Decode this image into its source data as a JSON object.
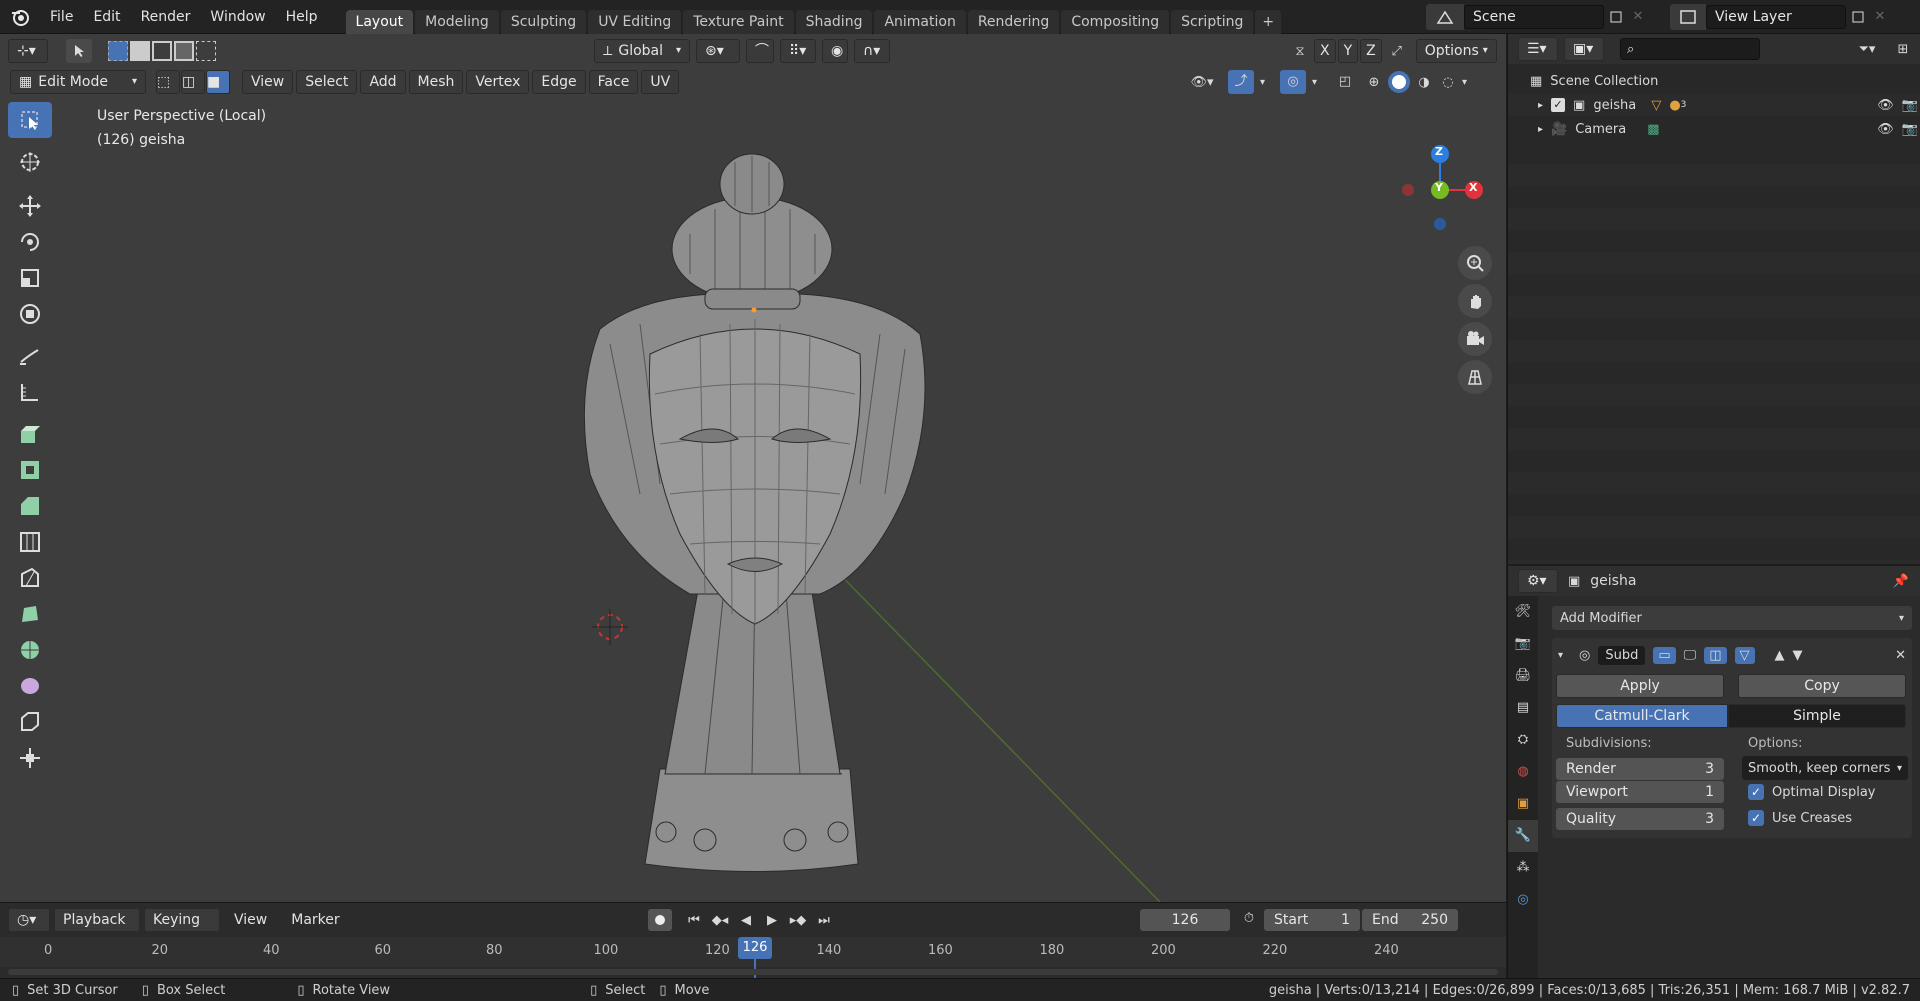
{
  "menu": [
    "File",
    "Edit",
    "Render",
    "Window",
    "Help"
  ],
  "workspaces": [
    "Layout",
    "Modeling",
    "Sculpting",
    "UV Editing",
    "Texture Paint",
    "Shading",
    "Animation",
    "Rendering",
    "Compositing",
    "Scripting"
  ],
  "active_workspace": "Layout",
  "scene_name": "Scene",
  "view_layer": "View Layer",
  "header": {
    "orientation": "Global",
    "axes": [
      "X",
      "Y",
      "Z"
    ],
    "options_label": "Options",
    "mode": "Edit Mode",
    "menus": [
      "View",
      "Select",
      "Add",
      "Mesh",
      "Vertex",
      "Edge",
      "Face",
      "UV"
    ]
  },
  "viewport": {
    "view_name": "User Perspective (Local)",
    "object_info": "(126) geisha",
    "axes": {
      "z": "Z",
      "y": "Y",
      "x": "X"
    }
  },
  "outliner": {
    "root": "Scene Collection",
    "items": [
      {
        "name": "geisha",
        "badge": "3"
      },
      {
        "name": "Camera",
        "badge": ""
      }
    ]
  },
  "properties": {
    "object_name": "geisha",
    "add_modifier": "Add Modifier",
    "modifier_name": "Subd",
    "apply": "Apply",
    "copy": "Copy",
    "algo_a": "Catmull-Clark",
    "algo_b": "Simple",
    "subdivisions_label": "Subdivisions:",
    "options_label": "Options:",
    "render_label": "Render",
    "render_value": "3",
    "viewport_label": "Viewport",
    "viewport_value": "1",
    "quality_label": "Quality",
    "quality_value": "3",
    "uv_smooth": "Smooth, keep corners",
    "optimal_display": "Optimal Display",
    "use_creases": "Use Creases"
  },
  "timeline": {
    "menus": [
      "Playback",
      "Keying",
      "View",
      "Marker"
    ],
    "current_frame": "126",
    "start_label": "Start",
    "start_value": "1",
    "end_label": "End",
    "end_value": "250",
    "ruler": [
      "0",
      "20",
      "40",
      "60",
      "80",
      "100",
      "120",
      "140",
      "160",
      "180",
      "200",
      "220",
      "240"
    ]
  },
  "status": {
    "left": [
      {
        "label": "Set 3D Cursor"
      },
      {
        "label": "Box Select"
      },
      {
        "label": "Rotate View"
      },
      {
        "label": "Select"
      },
      {
        "label": "Move"
      }
    ],
    "stats": "geisha | Verts:0/13,214 | Edges:0/26,899 | Faces:0/13,685 | Tris:26,351 | Mem: 168.7 MiB | v2.82.7"
  },
  "colors": {
    "accent": "#4772b3",
    "axis_x": "#e2333d",
    "axis_y": "#77bb22",
    "axis_z": "#2c7fe0"
  }
}
